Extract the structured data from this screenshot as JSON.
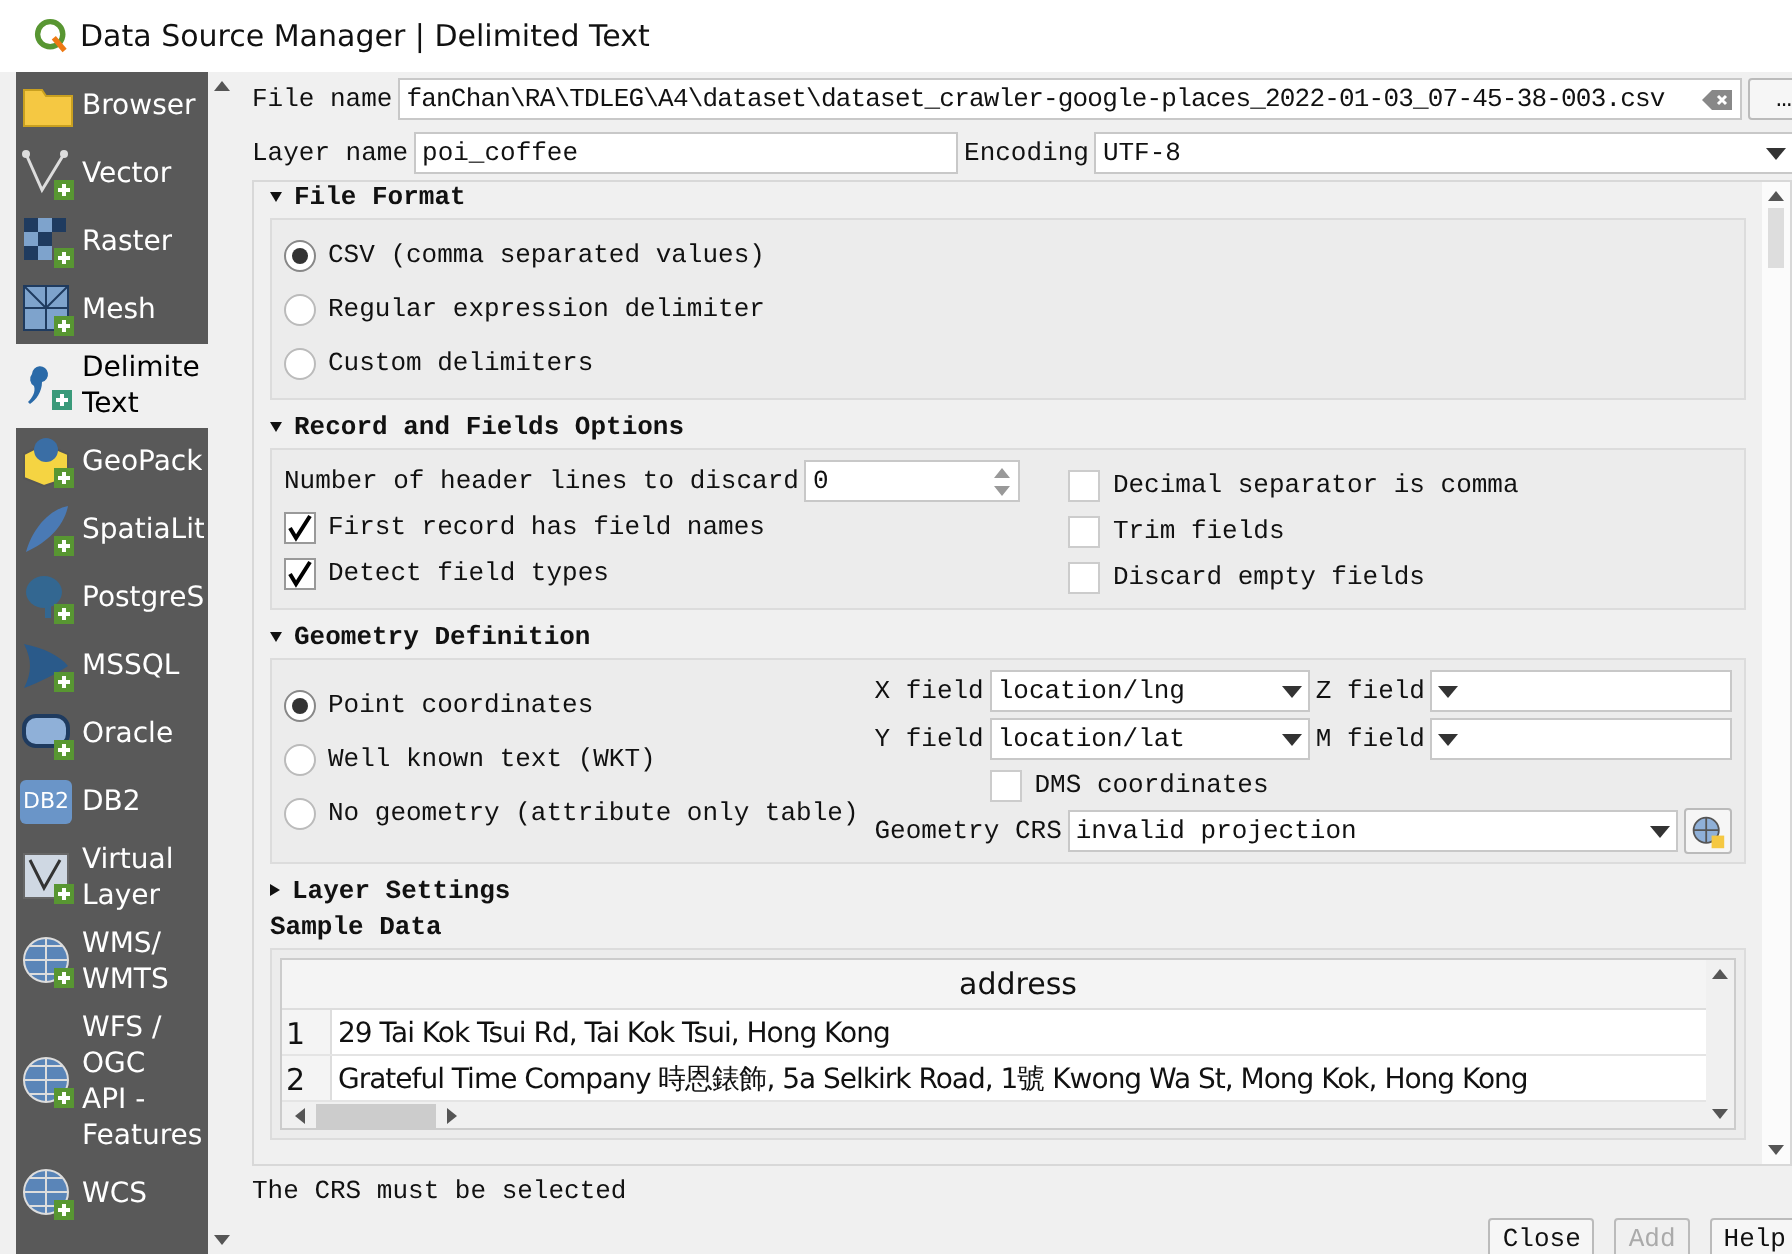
{
  "window": {
    "title": "Data Source Manager | Delimited Text"
  },
  "sidebar": {
    "items": [
      {
        "kind": "folder",
        "label": "Browser",
        "selected": false
      },
      {
        "kind": "vector",
        "label": "Vector",
        "selected": false
      },
      {
        "kind": "raster",
        "label": "Raster",
        "selected": false
      },
      {
        "kind": "mesh",
        "label": "Mesh",
        "selected": false
      },
      {
        "kind": "comma",
        "label": "Delimite\nText",
        "selected": true
      },
      {
        "kind": "geopackage",
        "label": "GeoPack",
        "selected": false
      },
      {
        "kind": "feather",
        "label": "SpatiaLit",
        "selected": false
      },
      {
        "kind": "elephant",
        "label": "PostgreS",
        "selected": false
      },
      {
        "kind": "sail",
        "label": "MSSQL",
        "selected": false
      },
      {
        "kind": "oracle",
        "label": "Oracle",
        "selected": false
      },
      {
        "kind": "db2",
        "label": "DB2",
        "selected": false,
        "badge": "DB2"
      },
      {
        "kind": "virtual",
        "label": "Virtual\nLayer",
        "selected": false
      },
      {
        "kind": "globe",
        "label": "WMS/\nWMTS",
        "selected": false
      },
      {
        "kind": "globe",
        "label": "WFS /\nOGC\nAPI -\nFeatures",
        "selected": false
      },
      {
        "kind": "globe",
        "label": "WCS",
        "selected": false
      }
    ]
  },
  "file_name": {
    "label": "File name",
    "value": "fanChan\\RA\\TDLEG\\A4\\dataset\\dataset_crawler-google-places_2022-01-03_07-45-38-003.csv",
    "browse": "…"
  },
  "layer_name": {
    "label": "Layer name",
    "value": "poi_coffee"
  },
  "encoding": {
    "label": "Encoding",
    "value": "UTF-8"
  },
  "file_format": {
    "title": "File Format",
    "expanded": true,
    "options": [
      {
        "label": "CSV (comma separated values)",
        "selected": true
      },
      {
        "label": "Regular expression delimiter",
        "selected": false
      },
      {
        "label": "Custom delimiters",
        "selected": false
      }
    ]
  },
  "record_options": {
    "title": "Record and Fields Options",
    "expanded": true,
    "header_lines": {
      "label": "Number of header lines to discard",
      "value": "0"
    },
    "left_checks": [
      {
        "label": "First record has field names",
        "checked": true
      },
      {
        "label": "Detect field types",
        "checked": true
      }
    ],
    "right_checks": [
      {
        "label": "Decimal separator is comma",
        "checked": false
      },
      {
        "label": "Trim fields",
        "checked": false
      },
      {
        "label": "Discard empty fields",
        "checked": false
      }
    ]
  },
  "geometry": {
    "title": "Geometry Definition",
    "expanded": true,
    "options": [
      {
        "label": "Point coordinates",
        "selected": true
      },
      {
        "label": "Well known text (WKT)",
        "selected": false
      },
      {
        "label": "No geometry (attribute only table)",
        "selected": false
      }
    ],
    "x_field": {
      "label": "X field",
      "value": "location/lng"
    },
    "y_field": {
      "label": "Y field",
      "value": "location/lat"
    },
    "z_field": {
      "label": "Z field"
    },
    "m_field": {
      "label": "M field"
    },
    "dms": {
      "label": "DMS coordinates",
      "checked": false
    },
    "crs": {
      "label": "Geometry CRS",
      "value": "invalid projection"
    }
  },
  "layer_settings": {
    "title": "Layer Settings",
    "expanded": false
  },
  "sample": {
    "title": "Sample Data",
    "columns": [
      "address"
    ],
    "rows": [
      {
        "index": "1",
        "cells": [
          "29 Tai Kok Tsui Rd, Tai Kok Tsui, Hong Kong"
        ]
      },
      {
        "index": "2",
        "cells": [
          "Grateful Time Company 時恩錶飾, 5a Selkirk Road, 1號 Kwong Wa St, Mong Kok, Hong Kong"
        ]
      }
    ]
  },
  "status": "The CRS must be selected",
  "buttons": [
    {
      "label": "Close",
      "disabled": false
    },
    {
      "label": "Add",
      "disabled": true
    },
    {
      "label": "Help",
      "disabled": false
    }
  ]
}
